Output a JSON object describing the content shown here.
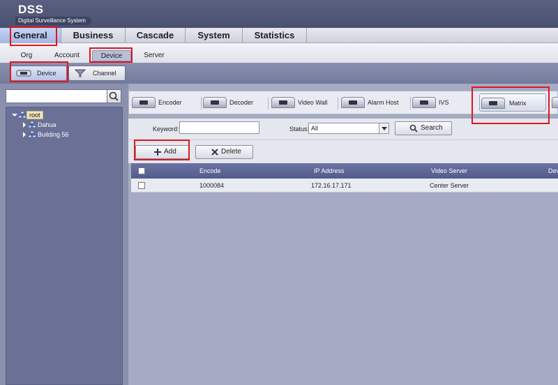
{
  "app": {
    "name": "DSS",
    "subtitle": "Digital Surveillance System"
  },
  "main_tabs": [
    "General",
    "Business",
    "Cascade",
    "System",
    "Statistics"
  ],
  "sub_nav": [
    "Org",
    "Account",
    "Device",
    "Server"
  ],
  "mode_buttons": [
    "Device",
    "Channel"
  ],
  "sidebar": {
    "search": {
      "value": "",
      "placeholder": ""
    },
    "tree": [
      {
        "label": "root",
        "expanded": true
      },
      {
        "label": "Dahua",
        "expanded": false
      },
      {
        "label": "Building 56",
        "expanded": false
      }
    ]
  },
  "device_types": [
    "Encoder",
    "Decoder",
    "Video Wall",
    "Alarm Host",
    "IVS",
    "Matrix"
  ],
  "filter": {
    "keyword_label": "Keyword:",
    "keyword_value": "",
    "status_label": "Status:",
    "status_value": "All",
    "search_label": "Search"
  },
  "actions": {
    "add": "Add",
    "delete": "Delete"
  },
  "table": {
    "columns": [
      "Encode",
      "IP Address",
      "Video Server",
      "Dev"
    ],
    "rows": [
      {
        "encode": "1000084",
        "ip": "172.16.17.171",
        "server": "Center Server"
      }
    ]
  },
  "colors": {
    "highlight": "#e0161e",
    "header_bg": "#535b8a",
    "accent": "#a6b6e0"
  }
}
